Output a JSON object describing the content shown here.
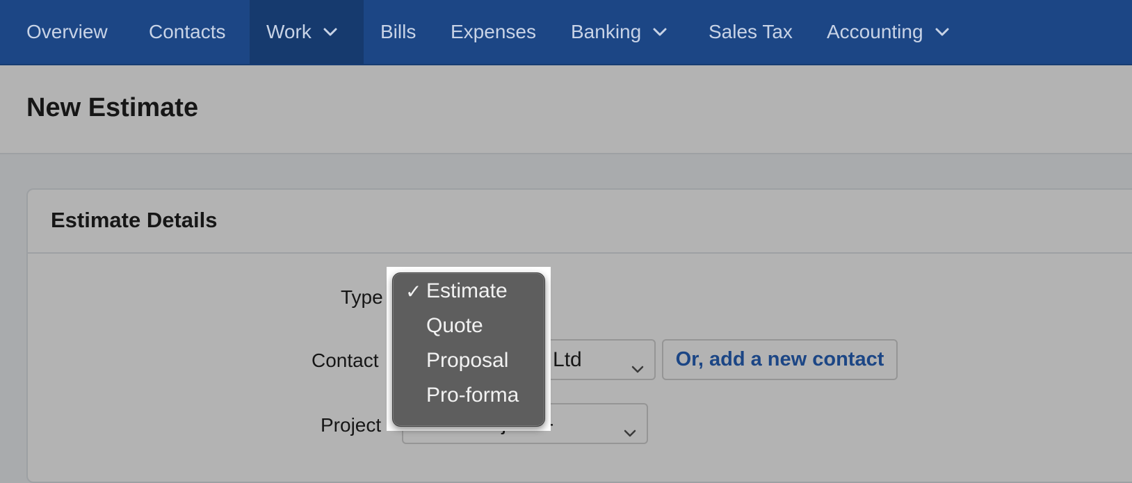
{
  "nav": {
    "items": [
      {
        "label": "Overview",
        "has_dropdown": false,
        "active": false
      },
      {
        "label": "Contacts",
        "has_dropdown": false,
        "active": false
      },
      {
        "label": "Work",
        "has_dropdown": true,
        "active": true
      },
      {
        "label": "Bills",
        "has_dropdown": false,
        "active": false
      },
      {
        "label": "Expenses",
        "has_dropdown": false,
        "active": false
      },
      {
        "label": "Banking",
        "has_dropdown": true,
        "active": false
      },
      {
        "label": "Sales Tax",
        "has_dropdown": false,
        "active": false
      },
      {
        "label": "Accounting",
        "has_dropdown": true,
        "active": false
      }
    ]
  },
  "page": {
    "title": "New Estimate"
  },
  "card": {
    "title": "Estimate Details"
  },
  "form": {
    "type_label": "Type",
    "contact_label": "Contact",
    "contact_value_visible": "g Ltd",
    "add_contact_label": "Or, add a new contact",
    "project_label": "Project",
    "project_value_visible": "No Project --"
  },
  "type_dropdown": {
    "selected": "Estimate",
    "check_glyph": "✓",
    "options": [
      "Estimate",
      "Quote",
      "Proposal",
      "Pro-forma"
    ]
  },
  "colors": {
    "nav_background": "#1c4685",
    "nav_active": "#163a6e",
    "accent": "#1c4685",
    "overlay_background": "#b3b3b3",
    "menu_background": "#5e5e5e"
  }
}
